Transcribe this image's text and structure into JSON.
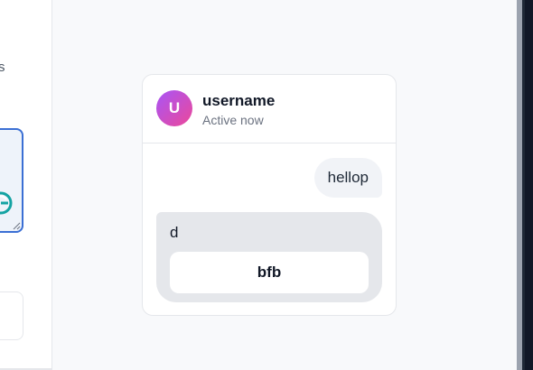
{
  "sidebar": {
    "partial_text": "s"
  },
  "chat": {
    "user": {
      "avatar_initial": "U",
      "name": "username",
      "status": "Active now"
    },
    "messages": [
      {
        "direction": "sent",
        "text": "hellop"
      },
      {
        "direction": "received",
        "text": "d",
        "action_label": "bfb"
      }
    ]
  },
  "colors": {
    "page_bg": "#f8f9fb",
    "avatar_gradient_start": "#a855f7",
    "avatar_gradient_end": "#ec4899",
    "textarea_focus_border": "#3b6fd4",
    "g_icon": "#14a3a3",
    "sent_bubble": "#f1f3f7",
    "received_bubble": "#e5e7eb"
  },
  "icons": {
    "sidebar_round_icon": "g-circle-icon",
    "textarea_resize": "resize-handle-icon"
  }
}
